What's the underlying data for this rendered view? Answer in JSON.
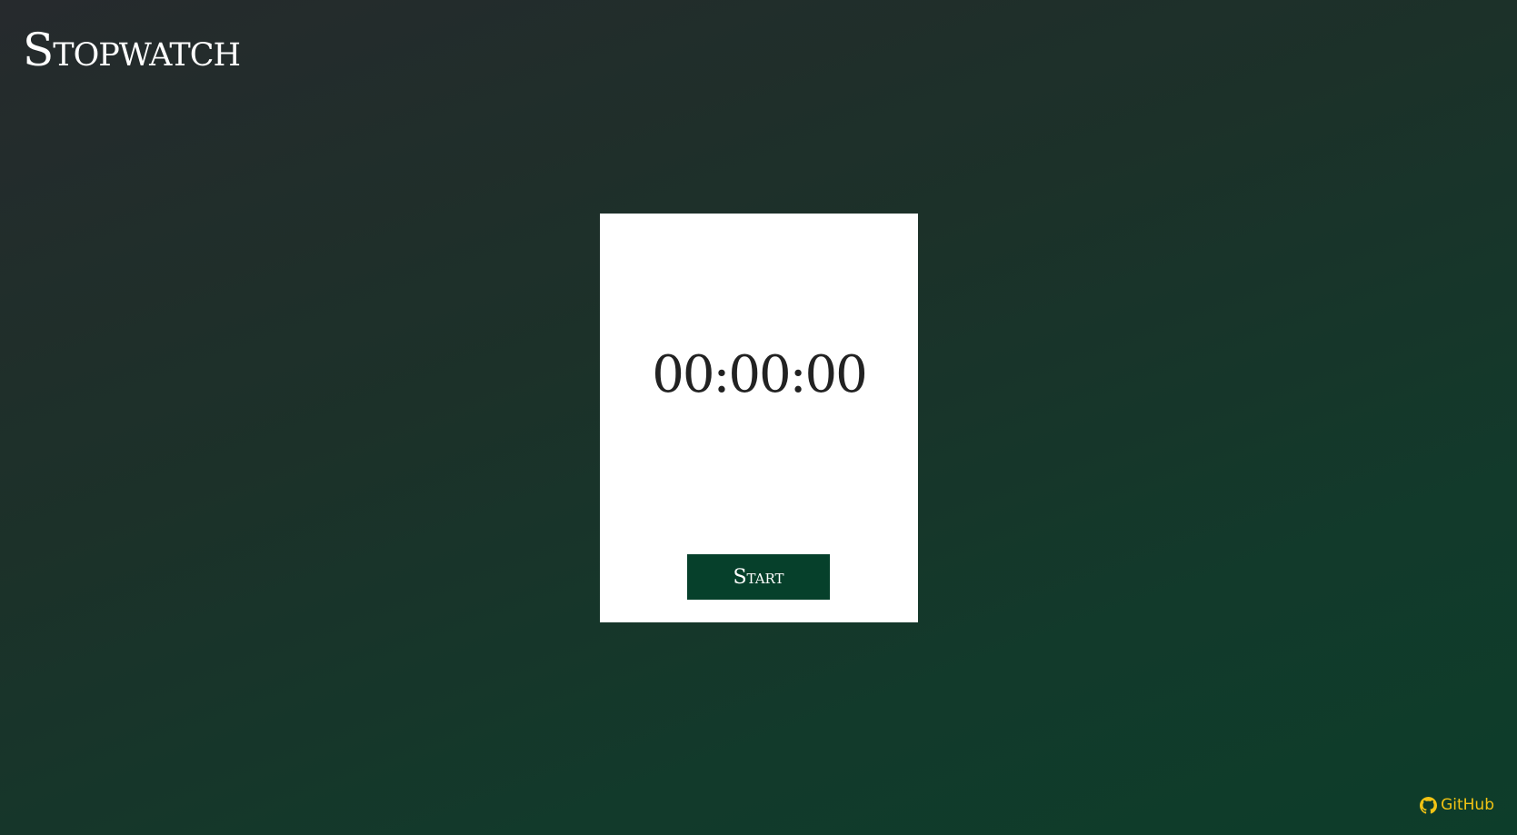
{
  "app": {
    "title": "Stopwatch"
  },
  "timer": {
    "display": "00:00:00"
  },
  "controls": {
    "start_label": "Start"
  },
  "footer": {
    "github_label": "GitHub",
    "github_icon": "github-icon"
  },
  "colors": {
    "button_background": "#06402b",
    "link_accent": "#f2c314",
    "card_background": "#ffffff"
  }
}
